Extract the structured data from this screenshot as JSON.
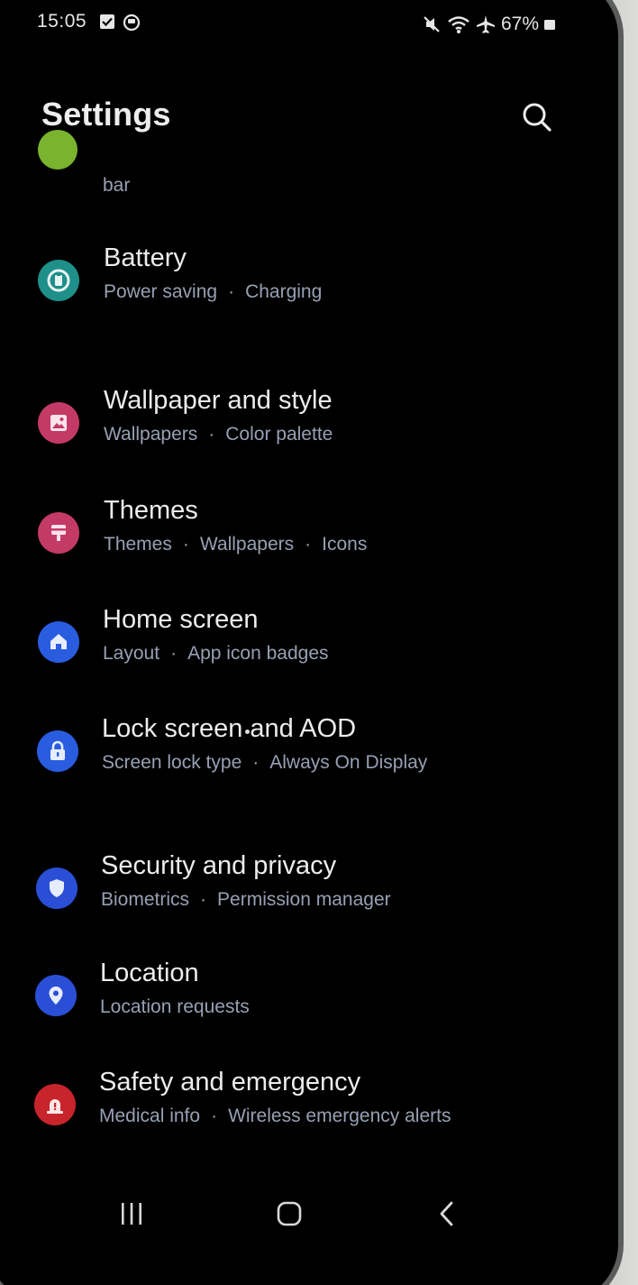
{
  "status_bar": {
    "time": "15:05",
    "battery_percent": "67%"
  },
  "header": {
    "title": "Settings"
  },
  "partial_item": {
    "subtitle_tail": "bar",
    "icon_color": "#7ab32e"
  },
  "items": [
    {
      "title": "Battery",
      "subtitle": [
        "Power saving",
        "Charging"
      ],
      "icon": "battery-icon",
      "color": "#1f8f8a"
    },
    {
      "title": "Wallpaper and style",
      "subtitle": [
        "Wallpapers",
        "Color palette"
      ],
      "icon": "wallpaper-icon",
      "color": "#c43a67"
    },
    {
      "title": "Themes",
      "subtitle": [
        "Themes",
        "Wallpapers",
        "Icons"
      ],
      "icon": "themes-icon",
      "color": "#c43a67"
    },
    {
      "title": "Home screen",
      "subtitle": [
        "Layout",
        "App icon badges"
      ],
      "icon": "home-icon",
      "color": "#2a5ce0"
    },
    {
      "title": "Lock screen and AOD",
      "subtitle": [
        "Screen lock type",
        "Always On Display"
      ],
      "icon": "lock-icon",
      "color": "#2a5ce0"
    },
    {
      "title": "Security and privacy",
      "subtitle": [
        "Biometrics",
        "Permission manager"
      ],
      "icon": "shield-icon",
      "color": "#2a4fd6"
    },
    {
      "title": "Location",
      "subtitle": [
        "Location requests"
      ],
      "icon": "location-pin-icon",
      "color": "#2a4fd6"
    },
    {
      "title": "Safety and emergency",
      "subtitle": [
        "Medical info",
        "Wireless emergency alerts"
      ],
      "icon": "emergency-icon",
      "color": "#c8242c"
    }
  ],
  "colors": {
    "background": "#000000",
    "title_text": "#ececec",
    "subtitle_text": "#97a0b3"
  }
}
